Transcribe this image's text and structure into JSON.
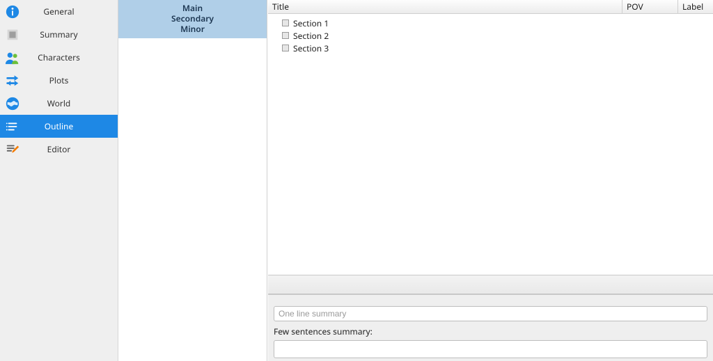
{
  "sidebar": {
    "items": [
      {
        "id": "general",
        "label": "General"
      },
      {
        "id": "summary",
        "label": "Summary"
      },
      {
        "id": "characters",
        "label": "Characters"
      },
      {
        "id": "plots",
        "label": "Plots"
      },
      {
        "id": "world",
        "label": "World"
      },
      {
        "id": "outline",
        "label": "Outline"
      },
      {
        "id": "editor",
        "label": "Editor"
      }
    ],
    "selected": "outline"
  },
  "midnav": {
    "items": [
      {
        "id": "main",
        "label": "Main"
      },
      {
        "id": "secondary",
        "label": "Secondary"
      },
      {
        "id": "minor",
        "label": "Minor"
      }
    ]
  },
  "tree": {
    "columns": {
      "title": "Title",
      "pov": "POV",
      "label": "Label"
    },
    "rows": [
      {
        "title": "Section 1",
        "pov": "",
        "label": ""
      },
      {
        "title": "Section 2",
        "pov": "",
        "label": ""
      },
      {
        "title": "Section 3",
        "pov": "",
        "label": ""
      }
    ]
  },
  "summary": {
    "one_line_placeholder": "One line summary",
    "one_line_value": "",
    "few_label": "Few sentences summary:",
    "few_value": ""
  }
}
